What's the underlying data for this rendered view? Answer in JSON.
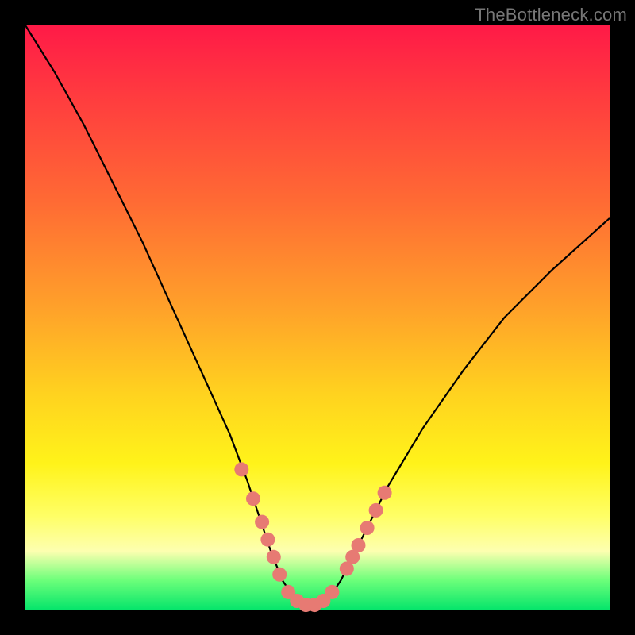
{
  "watermark": {
    "text": "TheBottleneck.com"
  },
  "colors": {
    "frame": "#000000",
    "curve_stroke": "#000000",
    "dot_fill": "#e77a73",
    "gradient_stops": [
      "#ff1a47",
      "#ff6a34",
      "#ffd21f",
      "#fdffb0",
      "#06e56b"
    ]
  },
  "chart_data": {
    "type": "line",
    "title": "",
    "xlabel": "",
    "ylabel": "",
    "xlim": [
      0,
      100
    ],
    "ylim": [
      0,
      100
    ],
    "grid": false,
    "legend": false,
    "note": "Background vertical gradient encodes value from red (top, 100) to green (bottom, 0). The black curve is a V-shaped valley reaching ~0 near x≈48; salmon dots mark points along the lower flanks and floor of the valley.",
    "series": [
      {
        "name": "valley-curve",
        "x": [
          0,
          5,
          10,
          15,
          20,
          25,
          30,
          35,
          38,
          40,
          42,
          44,
          46,
          48,
          50,
          52,
          54,
          56,
          58,
          62,
          68,
          75,
          82,
          90,
          100
        ],
        "y": [
          100,
          92,
          83,
          73,
          63,
          52,
          41,
          30,
          22,
          16,
          10,
          5,
          2,
          0,
          0,
          2,
          5,
          9,
          13,
          21,
          31,
          41,
          50,
          58,
          67
        ]
      }
    ],
    "dots": {
      "name": "highlight-dots",
      "x": [
        37,
        39,
        40.5,
        41.5,
        42.5,
        43.5,
        45,
        46.5,
        48,
        49.5,
        51,
        52.5,
        55,
        56,
        57,
        58.5,
        60,
        61.5
      ],
      "y": [
        24,
        19,
        15,
        12,
        9,
        6,
        3,
        1.5,
        0.8,
        0.8,
        1.5,
        3,
        7,
        9,
        11,
        14,
        17,
        20
      ]
    }
  }
}
